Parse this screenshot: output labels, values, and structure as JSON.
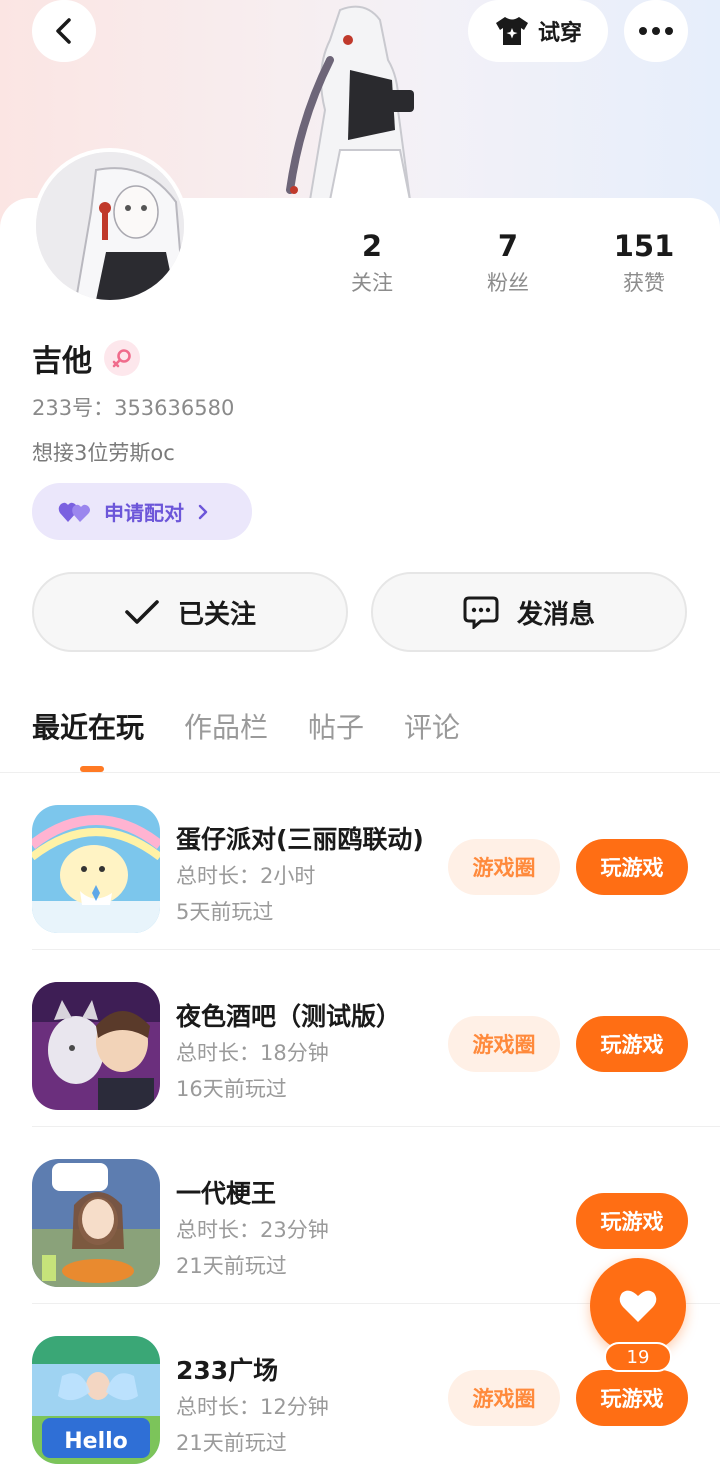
{
  "header": {
    "tryon_label": "试穿",
    "icons": [
      "chevron-left-icon",
      "tshirt-sparkle-icon",
      "more-icon"
    ]
  },
  "profile": {
    "name": "吉他",
    "uid": "233号：353636580",
    "bio": "想接3位劳斯oc",
    "gender": "female",
    "stats": [
      {
        "value": "2",
        "label": "关注"
      },
      {
        "value": "7",
        "label": "粉丝"
      },
      {
        "value": "151",
        "label": "获赞"
      }
    ],
    "match_label": "申请配对"
  },
  "actions": {
    "follow_label": "已关注",
    "message_label": "发消息"
  },
  "tabs": [
    {
      "label": "最近在玩",
      "active": true
    },
    {
      "label": "作品栏",
      "active": false
    },
    {
      "label": "帖子",
      "active": false
    },
    {
      "label": "评论",
      "active": false
    }
  ],
  "games": [
    {
      "title": "蛋仔派对(三丽鸥联动)",
      "duration": "总时长：2小时",
      "last_played": "5天前玩过",
      "circle_label": "游戏圈",
      "play_label": "玩游戏",
      "has_circle": true
    },
    {
      "title": "夜色酒吧（测试版）",
      "duration": "总时长：18分钟",
      "last_played": "16天前玩过",
      "circle_label": "游戏圈",
      "play_label": "玩游戏",
      "has_circle": true
    },
    {
      "title": "一代梗王",
      "duration": "总时长：23分钟",
      "last_played": "21天前玩过",
      "circle_label": "",
      "play_label": "玩游戏",
      "has_circle": false
    },
    {
      "title": "233广场",
      "duration": "总时长：12分钟",
      "last_played": "21天前玩过",
      "circle_label": "游戏圈",
      "play_label": "玩游戏",
      "has_circle": true
    }
  ],
  "like_fab": {
    "count": "19"
  },
  "colors": {
    "accent": "#ff6e14",
    "match_bg": "#ebe7fb",
    "match_text": "#6c56d9",
    "circle_bg": "#fff0e6",
    "circle_text": "#ff8a3c"
  }
}
